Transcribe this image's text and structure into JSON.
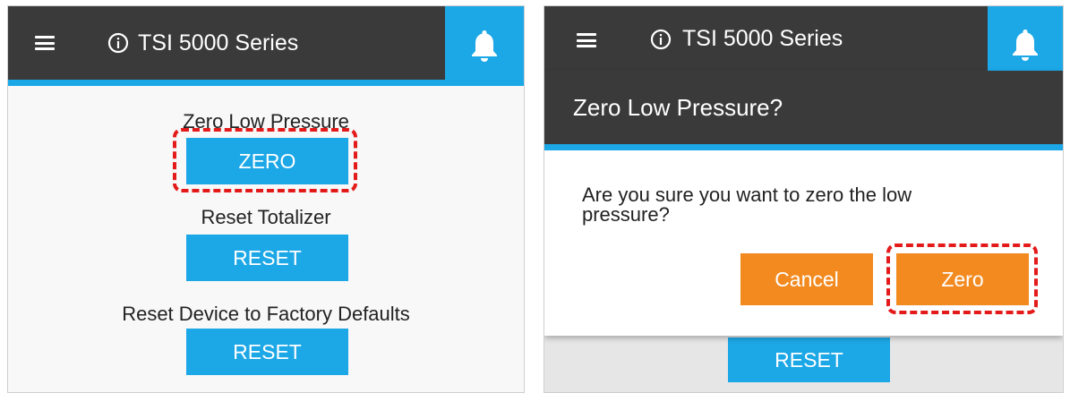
{
  "left_panel": {
    "header": {
      "title": "TSI 5000 Series",
      "menu_icon": "hamburger-menu-icon",
      "info_icon": "info-icon",
      "bell_icon": "bell-icon"
    },
    "settings": [
      {
        "label": "Zero Low Pressure",
        "button_label": "ZERO",
        "highlighted": true
      },
      {
        "label": "Reset Totalizer",
        "button_label": "RESET",
        "highlighted": false
      },
      {
        "label": "Reset Device to Factory Defaults",
        "button_label": "RESET",
        "highlighted": false
      }
    ]
  },
  "right_panel": {
    "header": {
      "title": "TSI 5000 Series",
      "menu_icon": "hamburger-menu-icon",
      "info_icon": "info-icon",
      "bell_icon": "bell-icon"
    },
    "background_button_label": "RESET",
    "dialog": {
      "title": "Zero Low Pressure?",
      "message": "Are you sure you want to zero the low pressure?",
      "cancel_label": "Cancel",
      "confirm_label": "Zero",
      "confirm_highlighted": true
    }
  },
  "colors": {
    "header_bg": "#3a3a3a",
    "accent_blue": "#1ca7e6",
    "button_orange": "#f28a20",
    "highlight_red": "#e41a1a"
  }
}
